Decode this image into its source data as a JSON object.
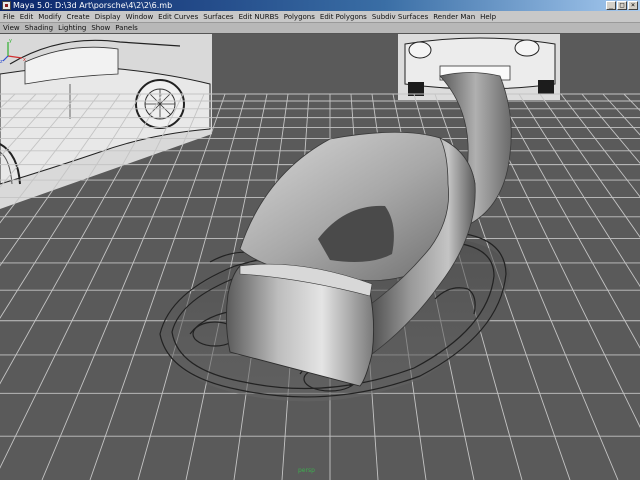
{
  "window": {
    "title": "Maya 5.0: D:\\3d Art\\porsche\\4\\2\\2\\6.mb",
    "controls": {
      "minimize": "_",
      "maximize": "□",
      "close": "×"
    }
  },
  "menubar": {
    "items": [
      "File",
      "Edit",
      "Modify",
      "Create",
      "Display",
      "Window",
      "Edit Curves",
      "Surfaces",
      "Edit NURBS",
      "Polygons",
      "Edit Polygons",
      "Subdiv Surfaces",
      "Render Man",
      "Help"
    ]
  },
  "panel_menu": {
    "items": [
      "View",
      "Shading",
      "Lighting",
      "Show",
      "Panels"
    ]
  },
  "viewport": {
    "camera_label": "persp",
    "axis_labels": {
      "x": "x",
      "y": "y",
      "z": "z"
    },
    "colors": {
      "background": "#5a5a5a",
      "grid": "#c8c8c8",
      "axis_x": "#d03030",
      "axis_y": "#30b030",
      "axis_z": "#3050d0"
    }
  }
}
